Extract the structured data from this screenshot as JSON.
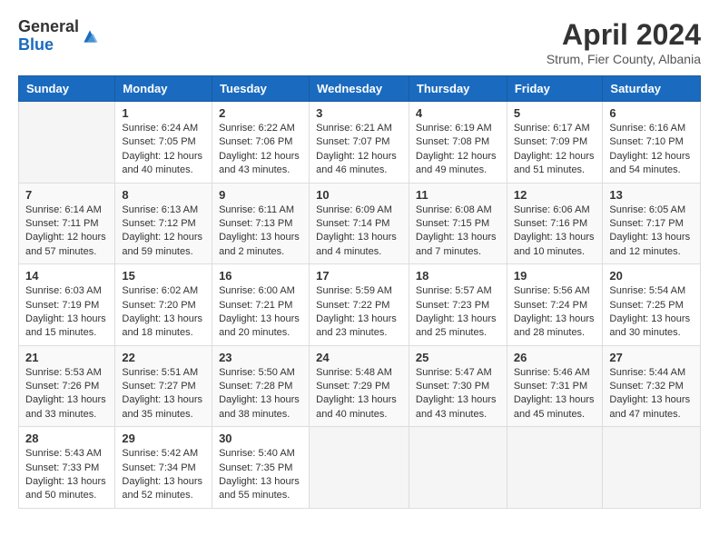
{
  "header": {
    "logo": {
      "general": "General",
      "blue": "Blue"
    },
    "title": "April 2024",
    "subtitle": "Strum, Fier County, Albania"
  },
  "days_of_week": [
    "Sunday",
    "Monday",
    "Tuesday",
    "Wednesday",
    "Thursday",
    "Friday",
    "Saturday"
  ],
  "weeks": [
    [
      {
        "day": "",
        "data": ""
      },
      {
        "day": "1",
        "data": "Sunrise: 6:24 AM\nSunset: 7:05 PM\nDaylight: 12 hours\nand 40 minutes."
      },
      {
        "day": "2",
        "data": "Sunrise: 6:22 AM\nSunset: 7:06 PM\nDaylight: 12 hours\nand 43 minutes."
      },
      {
        "day": "3",
        "data": "Sunrise: 6:21 AM\nSunset: 7:07 PM\nDaylight: 12 hours\nand 46 minutes."
      },
      {
        "day": "4",
        "data": "Sunrise: 6:19 AM\nSunset: 7:08 PM\nDaylight: 12 hours\nand 49 minutes."
      },
      {
        "day": "5",
        "data": "Sunrise: 6:17 AM\nSunset: 7:09 PM\nDaylight: 12 hours\nand 51 minutes."
      },
      {
        "day": "6",
        "data": "Sunrise: 6:16 AM\nSunset: 7:10 PM\nDaylight: 12 hours\nand 54 minutes."
      }
    ],
    [
      {
        "day": "7",
        "data": "Sunrise: 6:14 AM\nSunset: 7:11 PM\nDaylight: 12 hours\nand 57 minutes."
      },
      {
        "day": "8",
        "data": "Sunrise: 6:13 AM\nSunset: 7:12 PM\nDaylight: 12 hours\nand 59 minutes."
      },
      {
        "day": "9",
        "data": "Sunrise: 6:11 AM\nSunset: 7:13 PM\nDaylight: 13 hours\nand 2 minutes."
      },
      {
        "day": "10",
        "data": "Sunrise: 6:09 AM\nSunset: 7:14 PM\nDaylight: 13 hours\nand 4 minutes."
      },
      {
        "day": "11",
        "data": "Sunrise: 6:08 AM\nSunset: 7:15 PM\nDaylight: 13 hours\nand 7 minutes."
      },
      {
        "day": "12",
        "data": "Sunrise: 6:06 AM\nSunset: 7:16 PM\nDaylight: 13 hours\nand 10 minutes."
      },
      {
        "day": "13",
        "data": "Sunrise: 6:05 AM\nSunset: 7:17 PM\nDaylight: 13 hours\nand 12 minutes."
      }
    ],
    [
      {
        "day": "14",
        "data": "Sunrise: 6:03 AM\nSunset: 7:19 PM\nDaylight: 13 hours\nand 15 minutes."
      },
      {
        "day": "15",
        "data": "Sunrise: 6:02 AM\nSunset: 7:20 PM\nDaylight: 13 hours\nand 18 minutes."
      },
      {
        "day": "16",
        "data": "Sunrise: 6:00 AM\nSunset: 7:21 PM\nDaylight: 13 hours\nand 20 minutes."
      },
      {
        "day": "17",
        "data": "Sunrise: 5:59 AM\nSunset: 7:22 PM\nDaylight: 13 hours\nand 23 minutes."
      },
      {
        "day": "18",
        "data": "Sunrise: 5:57 AM\nSunset: 7:23 PM\nDaylight: 13 hours\nand 25 minutes."
      },
      {
        "day": "19",
        "data": "Sunrise: 5:56 AM\nSunset: 7:24 PM\nDaylight: 13 hours\nand 28 minutes."
      },
      {
        "day": "20",
        "data": "Sunrise: 5:54 AM\nSunset: 7:25 PM\nDaylight: 13 hours\nand 30 minutes."
      }
    ],
    [
      {
        "day": "21",
        "data": "Sunrise: 5:53 AM\nSunset: 7:26 PM\nDaylight: 13 hours\nand 33 minutes."
      },
      {
        "day": "22",
        "data": "Sunrise: 5:51 AM\nSunset: 7:27 PM\nDaylight: 13 hours\nand 35 minutes."
      },
      {
        "day": "23",
        "data": "Sunrise: 5:50 AM\nSunset: 7:28 PM\nDaylight: 13 hours\nand 38 minutes."
      },
      {
        "day": "24",
        "data": "Sunrise: 5:48 AM\nSunset: 7:29 PM\nDaylight: 13 hours\nand 40 minutes."
      },
      {
        "day": "25",
        "data": "Sunrise: 5:47 AM\nSunset: 7:30 PM\nDaylight: 13 hours\nand 43 minutes."
      },
      {
        "day": "26",
        "data": "Sunrise: 5:46 AM\nSunset: 7:31 PM\nDaylight: 13 hours\nand 45 minutes."
      },
      {
        "day": "27",
        "data": "Sunrise: 5:44 AM\nSunset: 7:32 PM\nDaylight: 13 hours\nand 47 minutes."
      }
    ],
    [
      {
        "day": "28",
        "data": "Sunrise: 5:43 AM\nSunset: 7:33 PM\nDaylight: 13 hours\nand 50 minutes."
      },
      {
        "day": "29",
        "data": "Sunrise: 5:42 AM\nSunset: 7:34 PM\nDaylight: 13 hours\nand 52 minutes."
      },
      {
        "day": "30",
        "data": "Sunrise: 5:40 AM\nSunset: 7:35 PM\nDaylight: 13 hours\nand 55 minutes."
      },
      {
        "day": "",
        "data": ""
      },
      {
        "day": "",
        "data": ""
      },
      {
        "day": "",
        "data": ""
      },
      {
        "day": "",
        "data": ""
      }
    ]
  ]
}
